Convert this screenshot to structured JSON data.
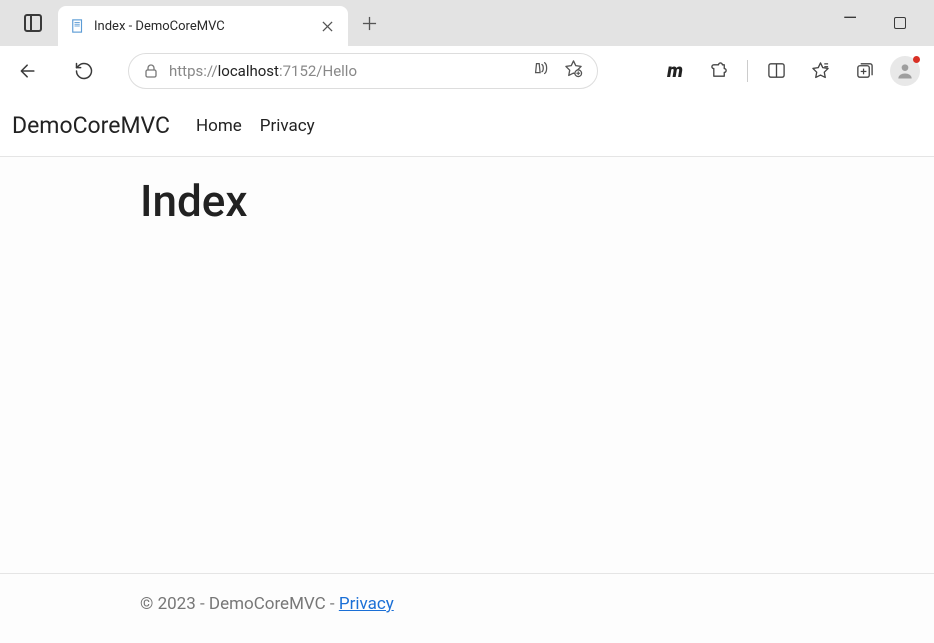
{
  "browser": {
    "tab": {
      "title": "Index - DemoCoreMVC"
    },
    "url": {
      "scheme": "https://",
      "host": "localhost",
      "port_path": ":7152/Hello"
    }
  },
  "page": {
    "navbar": {
      "brand": "DemoCoreMVC",
      "links": [
        {
          "label": "Home"
        },
        {
          "label": "Privacy"
        }
      ]
    },
    "heading": "Index",
    "footer": {
      "prefix": "© 2023 - DemoCoreMVC - ",
      "link_label": "Privacy"
    }
  }
}
